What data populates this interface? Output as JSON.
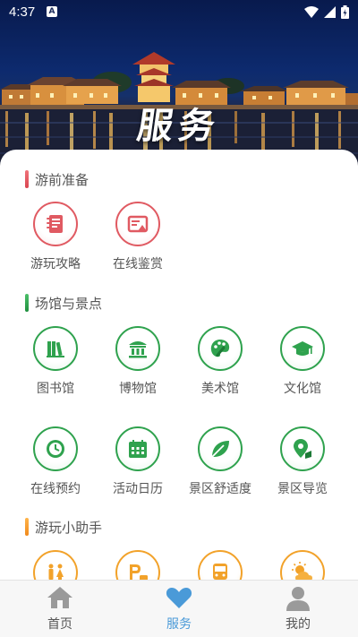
{
  "status_bar": {
    "time": "4:37",
    "indicator": "A"
  },
  "hero": {
    "title": "服务"
  },
  "sections": [
    {
      "title": "游前准备",
      "accent": "#e05a62",
      "items": [
        {
          "label": "游玩攻略",
          "icon": "notebook-icon"
        },
        {
          "label": "在线鉴赏",
          "icon": "picture-board-icon"
        }
      ]
    },
    {
      "title": "场馆与景点",
      "accent": "#2fa24e",
      "items": [
        {
          "label": "图书馆",
          "icon": "books-icon"
        },
        {
          "label": "博物馆",
          "icon": "museum-icon"
        },
        {
          "label": "美术馆",
          "icon": "palette-icon"
        },
        {
          "label": "文化馆",
          "icon": "graduation-cap-icon"
        },
        {
          "label": "在线预约",
          "icon": "clock-icon"
        },
        {
          "label": "活动日历",
          "icon": "calendar-icon"
        },
        {
          "label": "景区舒适度",
          "icon": "leaf-icon"
        },
        {
          "label": "景区导览",
          "icon": "map-pin-icon"
        }
      ]
    },
    {
      "title": "游玩小助手",
      "accent": "#f2a22a",
      "items": [
        {
          "label": "",
          "icon": "restroom-icon"
        },
        {
          "label": "",
          "icon": "parking-icon"
        },
        {
          "label": "",
          "icon": "bus-icon"
        },
        {
          "label": "",
          "icon": "weather-icon"
        }
      ]
    }
  ],
  "bottom_nav": {
    "active_color": "#4a9ad8",
    "items": [
      {
        "label": "首页",
        "icon": "home-icon"
      },
      {
        "label": "服务",
        "icon": "heart-icon"
      },
      {
        "label": "我的",
        "icon": "user-icon"
      }
    ]
  }
}
